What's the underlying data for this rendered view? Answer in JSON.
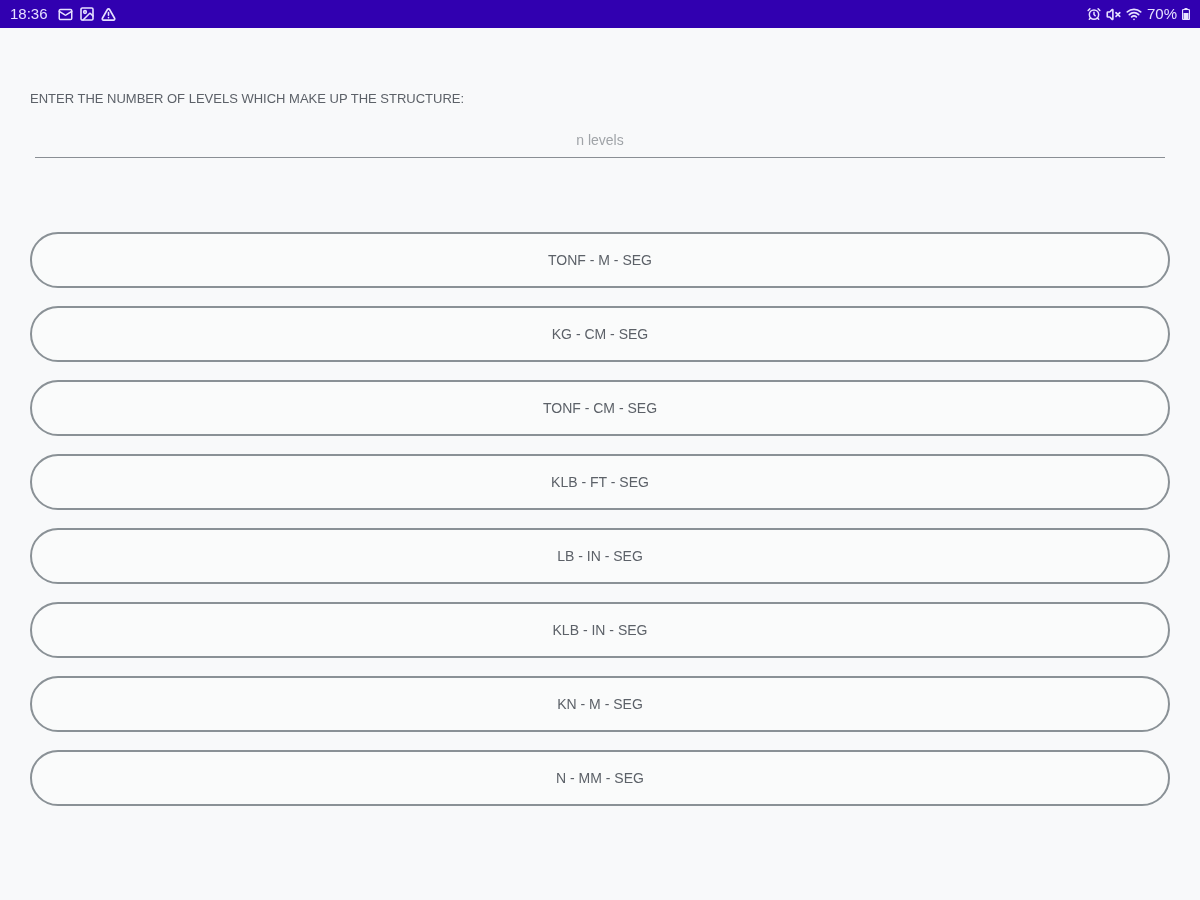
{
  "status_bar": {
    "time": "18:36",
    "battery": "70%"
  },
  "prompt": "ENTER THE NUMBER OF LEVELS WHICH MAKE UP THE STRUCTURE:",
  "levels_field": {
    "placeholder": "n levels"
  },
  "unit_buttons": [
    "TONF - M - SEG",
    "KG - CM - SEG",
    "TONF - CM - SEG",
    "KLB - FT - SEG",
    "LB - IN - SEG",
    "KLB - IN - SEG",
    "KN - M - SEG",
    "N - MM - SEG"
  ]
}
